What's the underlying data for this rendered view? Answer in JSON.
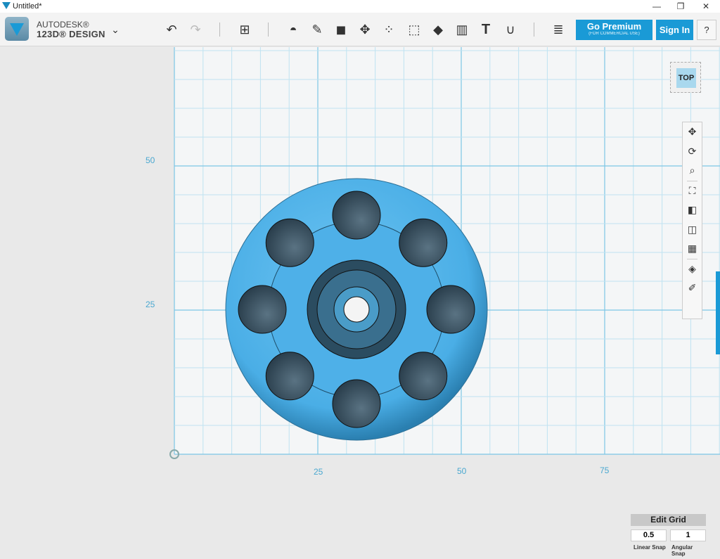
{
  "window": {
    "title": "Untitled*",
    "minimize": "—",
    "restore": "❐",
    "close": "✕"
  },
  "app": {
    "brand_line1": "AUTODESK®",
    "brand_line2": "123D® DESIGN",
    "menu_icon": "chevron-down-icon"
  },
  "toolbar": {
    "tools": [
      "undo",
      "redo",
      "primitives",
      "sketch",
      "construct",
      "modify",
      "pattern",
      "group",
      "combine",
      "measure",
      "text",
      "snap",
      "materials"
    ],
    "premium_label": "Go Premium",
    "premium_sub": "(FOR COMMERCIAL USE)",
    "signin_label": "Sign In",
    "help_label": "?"
  },
  "viewport": {
    "axis_labels_x": [
      "25",
      "50",
      "75"
    ],
    "axis_labels_y": [
      "50",
      "25"
    ],
    "view_cube": "TOP",
    "nav_tools": [
      "pan",
      "orbit",
      "zoom",
      "fit",
      "views",
      "show-hide",
      "grid-toggle",
      "material",
      "solid-sketch"
    ]
  },
  "grid_panel": {
    "edit_label": "Edit Grid",
    "linear_value": "0.5",
    "angular_value": "1",
    "linear_label": "Linear Snap",
    "angular_label": "Angular Snap"
  },
  "colors": {
    "accent": "#1a9ad6",
    "model": "#4aaee6",
    "grid": "#9fd6ec"
  }
}
